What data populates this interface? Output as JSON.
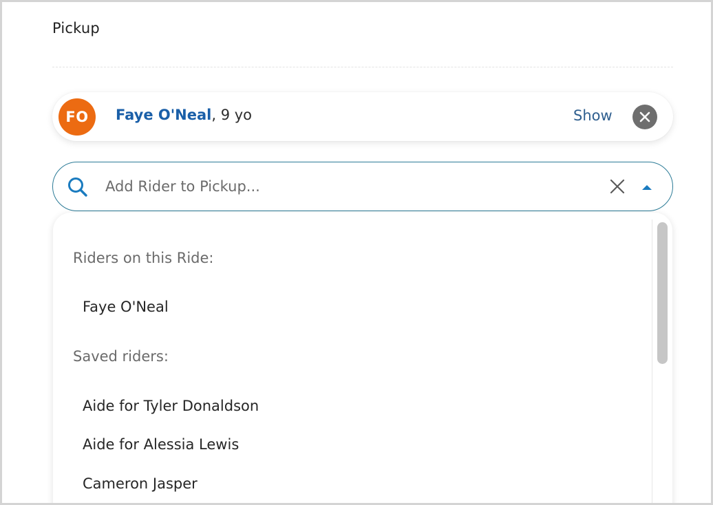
{
  "section": {
    "title": "Pickup"
  },
  "rider": {
    "initials": "FO",
    "avatar_color": "#ec6b12",
    "name": "Faye O'Neal",
    "age_suffix": ", 9 yo",
    "show_label": "Show",
    "remove_icon": "close-circle-icon"
  },
  "search": {
    "placeholder": "Add Rider to Pickup...",
    "value": "",
    "clear_icon": "close-icon",
    "toggle_icon": "caret-up-icon",
    "accent_color": "#2a7a96"
  },
  "dropdown": {
    "groups": [
      {
        "label": "Riders on this Ride:",
        "options": [
          "Faye O'Neal"
        ]
      },
      {
        "label": "Saved riders:",
        "options": [
          "Aide for Tyler Donaldson",
          "Aide for Alessia Lewis",
          "Cameron Jasper"
        ]
      }
    ]
  }
}
